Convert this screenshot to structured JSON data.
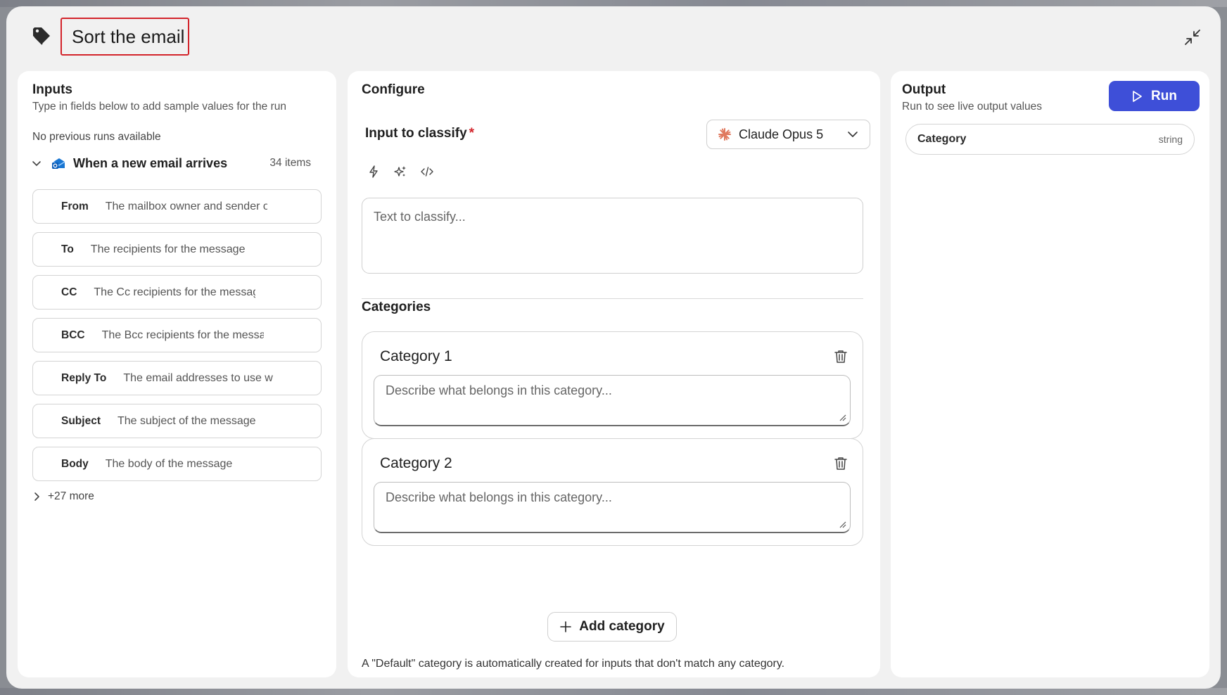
{
  "dialog": {
    "title": "Sort the email"
  },
  "inputs": {
    "title": "Inputs",
    "subtitle": "Type in fields below to add sample values for the run",
    "no_runs": "No previous runs available",
    "trigger": {
      "name": "When a new email arrives",
      "count": "34 items"
    },
    "fields": [
      {
        "label": "From",
        "value": "The mailbox owner and sender o"
      },
      {
        "label": "To",
        "value": "The recipients for the message"
      },
      {
        "label": "CC",
        "value": "The Cc recipients for the message"
      },
      {
        "label": "BCC",
        "value": "The Bcc recipients for the messag"
      },
      {
        "label": "Reply To",
        "value": "The email addresses to use w"
      },
      {
        "label": "Subject",
        "value": "The subject of the message"
      },
      {
        "label": "Body",
        "value": "The body of the message"
      }
    ],
    "more": "+27 more"
  },
  "configure": {
    "title": "Configure",
    "input_label": "Input to classify",
    "required_mark": "*",
    "model": "Claude Opus 5",
    "classify_placeholder": "Text to classify...",
    "categories_label": "Categories",
    "categories": [
      {
        "title": "Category 1",
        "placeholder": "Describe what belongs in this category..."
      },
      {
        "title": "Category 2",
        "placeholder": "Describe what belongs in this category..."
      }
    ],
    "add_category": "Add category",
    "footnote": "A \"Default\" category is automatically created for inputs that don't match any category."
  },
  "output": {
    "title": "Output",
    "subtitle": "Run to see live output values",
    "run_label": "Run",
    "field": {
      "name": "Category",
      "type": "string"
    }
  },
  "colors": {
    "accent": "#3e4fd8",
    "highlight_border": "#d3242b",
    "model_star": "#e07a5f"
  },
  "icons": {
    "header": "tag-icon",
    "collapse": "collapse-icon",
    "trigger_app": "outlook-email-icon",
    "tools": [
      "lightning-icon",
      "sparkle-icon",
      "code-icon"
    ],
    "model": "claude-star-icon",
    "delete": "trash-icon",
    "add": "plus-icon",
    "run": "play-icon"
  }
}
